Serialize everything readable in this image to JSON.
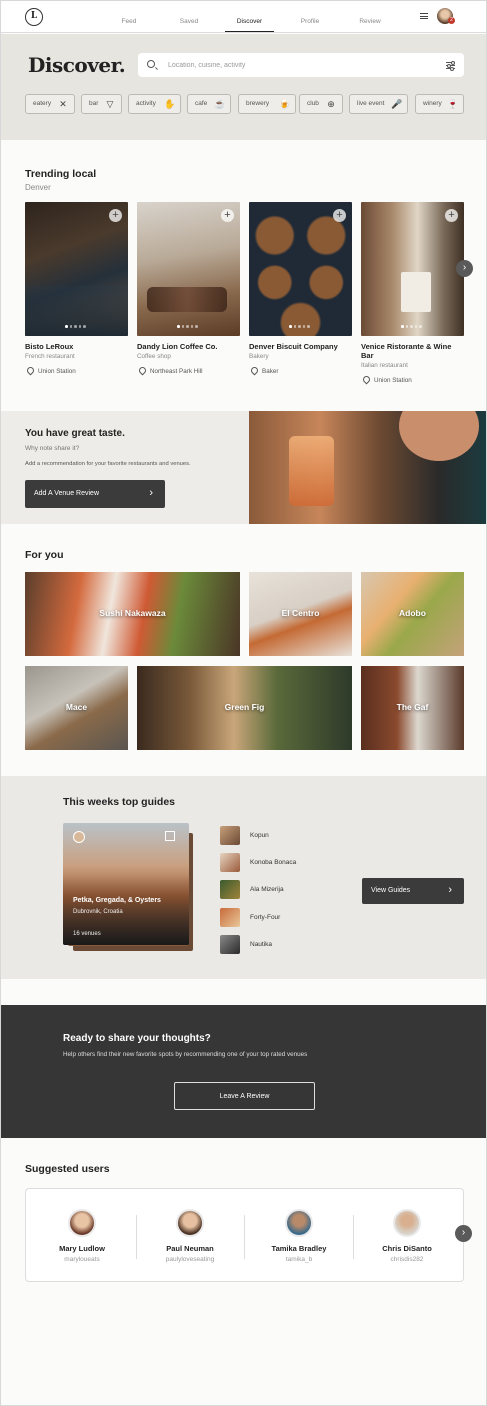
{
  "nav": {
    "logo": "L",
    "tabs": [
      "Feed",
      "Saved",
      "Discover",
      "Profile",
      "Review"
    ],
    "active_tab": "Discover",
    "notification_count": "2"
  },
  "discover": {
    "title": "Discover.",
    "search_placeholder": "Location, cuisine, activity",
    "chips": [
      {
        "label": "eatery",
        "icon": "fork-knife-icon",
        "glyph": "✕"
      },
      {
        "label": "bar",
        "icon": "cocktail-icon",
        "glyph": "▽"
      },
      {
        "label": "activity",
        "icon": "hand-icon",
        "glyph": "✋"
      },
      {
        "label": "cafe",
        "icon": "coffee-cup-icon",
        "glyph": "☕"
      },
      {
        "label": "brewery",
        "icon": "beer-mug-icon",
        "glyph": "🍺"
      },
      {
        "label": "club",
        "icon": "globe-icon",
        "glyph": "⊕"
      },
      {
        "label": "live event",
        "icon": "microphone-icon",
        "glyph": "🎤"
      },
      {
        "label": "winery",
        "icon": "wine-glass-icon",
        "glyph": "🍷"
      }
    ]
  },
  "trending": {
    "title": "Trending local",
    "city": "Denver",
    "venues": [
      {
        "name": "Bisto LeRoux",
        "type": "French restaurant",
        "location": "Union Station"
      },
      {
        "name": "Dandy Lion Coffee Co.",
        "type": "Coffee shop",
        "location": "Northeast Park Hill"
      },
      {
        "name": "Denver Biscuit Company",
        "type": "Bakery",
        "location": "Baker"
      },
      {
        "name": "Venice Ristorante & Wine Bar",
        "type": "Italian restaurant",
        "location": "Union Station"
      }
    ]
  },
  "taste": {
    "title": "You have great taste.",
    "subtitle": "Why note share it?",
    "body": "Add a recommendation for your favorite restaurants and venues.",
    "button": "Add A Venue Review"
  },
  "for_you": {
    "title": "For you",
    "tiles": [
      "Sushi Nakawaza",
      "El Centro",
      "Adobo",
      "Mace",
      "Green Fig",
      "The Gaf"
    ]
  },
  "guides": {
    "title": "This weeks top guides",
    "featured": {
      "name": "Petka, Gregada, & Oysters",
      "location": "Dubrovnik, Croatia",
      "count": "16 venues"
    },
    "items": [
      "Kopun",
      "Konoba Bonaca",
      "Ala Mizerija",
      "Forty-Four",
      "Nautika"
    ],
    "button": "View Guides"
  },
  "ready": {
    "title": "Ready to share your thoughts?",
    "body": "Help others find their new favorite spots by recommending one of your top rated venues",
    "button": "Leave A Review"
  },
  "users": {
    "title": "Suggested users",
    "list": [
      {
        "name": "Mary Ludlow",
        "handle": "maryloueats"
      },
      {
        "name": "Paul Neuman",
        "handle": "paulyloveseating"
      },
      {
        "name": "Tamika Bradley",
        "handle": "tamika_b"
      },
      {
        "name": "Chris DiSanto",
        "handle": "chrisdis282"
      }
    ]
  },
  "icons": {
    "plus": "+",
    "chevron_right": "›",
    "map": "▯"
  },
  "colors": {
    "band": "#e7e5e0",
    "dark": "#363636",
    "button_dark": "#3b3b3b",
    "notification": "#c0392b"
  }
}
